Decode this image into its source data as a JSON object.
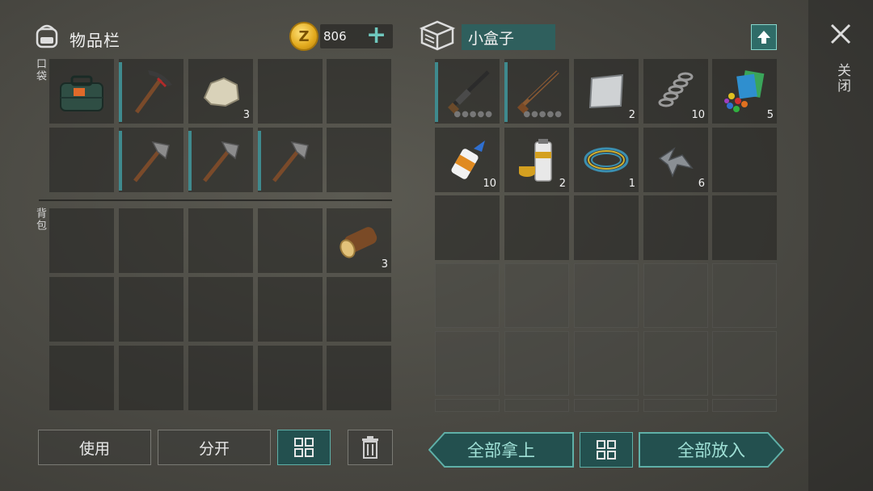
{
  "inventory": {
    "title": "物品栏",
    "money": "806",
    "pocket_label": "口袋",
    "backpack_label": "背包"
  },
  "box": {
    "name": "小盒子"
  },
  "close_label": "关闭",
  "pocket_items": [
    {
      "name": "first-aid-kit",
      "count": ""
    },
    {
      "name": "pickaxe",
      "count": ""
    },
    {
      "name": "stone",
      "count": "3"
    },
    {
      "name": "hatchet",
      "count": ""
    },
    {
      "name": "hatchet",
      "count": ""
    },
    {
      "name": "hatchet",
      "count": ""
    }
  ],
  "backpack_items": [
    {
      "name": "log",
      "count": "3"
    }
  ],
  "box_items": [
    {
      "name": "shotgun",
      "count": ""
    },
    {
      "name": "rifle",
      "count": ""
    },
    {
      "name": "metal-sheet",
      "count": "2"
    },
    {
      "name": "spring",
      "count": "10"
    },
    {
      "name": "colored-pieces",
      "count": "5"
    },
    {
      "name": "glue",
      "count": "10"
    },
    {
      "name": "paint-can",
      "count": "2"
    },
    {
      "name": "wire",
      "count": "1"
    },
    {
      "name": "metal-scrap",
      "count": "6"
    }
  ],
  "buttons": {
    "use": "使用",
    "split": "分开",
    "take_all": "全部拿上",
    "put_all": "全部放入"
  },
  "icons": {
    "backpack": "backpack-icon",
    "coin": "coin-icon",
    "plus": "plus-icon",
    "box": "box-icon",
    "upload": "upload-icon",
    "close": "close-icon",
    "grid": "grid-icon",
    "trash": "trash-icon"
  },
  "colors": {
    "accent": "#5fb0a8",
    "teal_dark": "#23504f",
    "coin": "#e2a91c"
  }
}
